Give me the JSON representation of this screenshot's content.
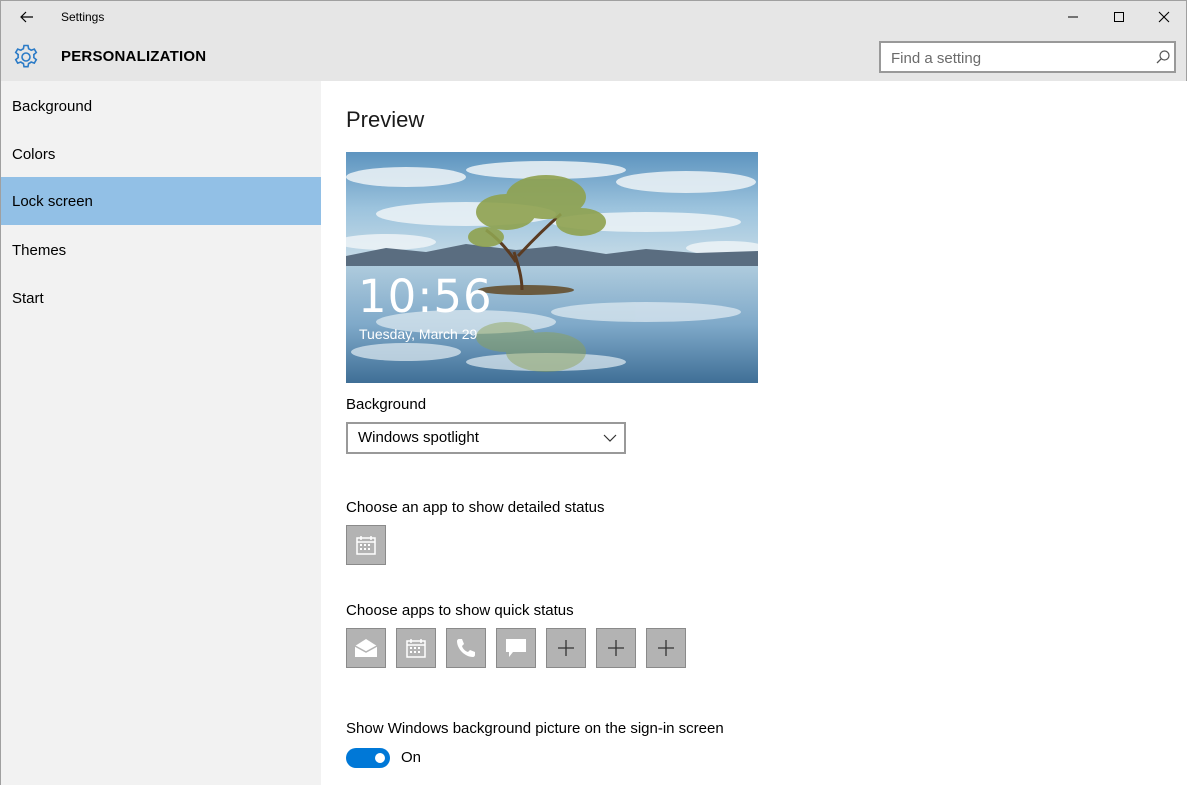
{
  "titlebar": {
    "app_title": "Settings",
    "back_icon": "back-arrow-icon",
    "minimize_icon": "minimize-icon",
    "maximize_icon": "maximize-icon",
    "close_icon": "close-icon"
  },
  "header": {
    "section_title": "PERSONALIZATION",
    "icon": "gear-icon",
    "search": {
      "placeholder": "Find a setting",
      "value": ""
    }
  },
  "sidebar": {
    "items": [
      {
        "label": "Background",
        "selected": false
      },
      {
        "label": "Colors",
        "selected": false
      },
      {
        "label": "Lock screen",
        "selected": true
      },
      {
        "label": "Themes",
        "selected": false
      },
      {
        "label": "Start",
        "selected": false
      }
    ]
  },
  "main": {
    "preview_title": "Preview",
    "preview": {
      "time": "10:56",
      "date": "Tuesday, March 29"
    },
    "background": {
      "label": "Background",
      "selected": "Windows spotlight"
    },
    "detailed_status": {
      "label": "Choose an app to show detailed status",
      "apps": [
        "calendar-icon"
      ]
    },
    "quick_status": {
      "label": "Choose apps to show quick status",
      "apps": [
        "mail-icon",
        "calendar-icon",
        "phone-icon",
        "message-icon",
        "plus-icon",
        "plus-icon",
        "plus-icon"
      ]
    },
    "signin_background": {
      "label": "Show Windows background picture on the sign-in screen",
      "state": "On",
      "enabled": true
    }
  },
  "colors": {
    "accent": "#0078d7",
    "selected_nav": "#92c0e6",
    "sidebar_bg": "#f2f2f2",
    "chrome_bg": "#e6e6e6",
    "tile_bg": "#b3b3b3"
  }
}
